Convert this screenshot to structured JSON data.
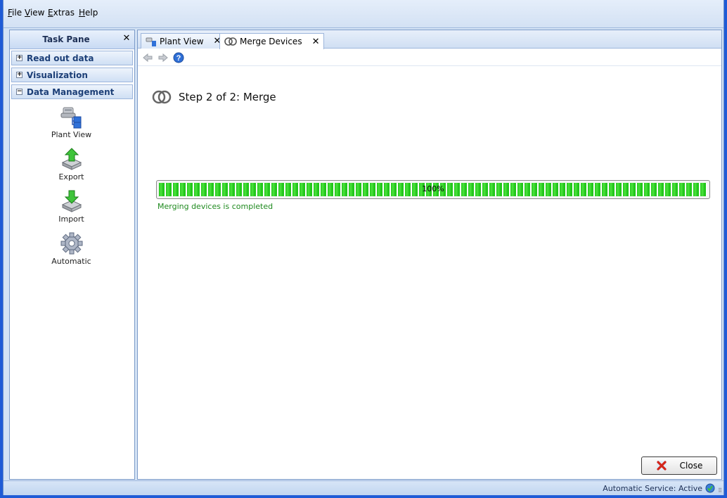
{
  "menu": {
    "file": {
      "ul": "F",
      "rest": "ile"
    },
    "view": {
      "ul": "V",
      "rest": "iew"
    },
    "extras": {
      "ul": "E",
      "rest": "xtras"
    },
    "help": {
      "ul": "H",
      "rest": "elp"
    }
  },
  "task_pane": {
    "title": "Task Pane",
    "groups": [
      {
        "label": "Read out data",
        "state": "+"
      },
      {
        "label": "Visualization",
        "state": "+"
      },
      {
        "label": "Data Management",
        "state": "−"
      }
    ],
    "items": [
      {
        "label": "Plant View",
        "icon": "plant-view-icon"
      },
      {
        "label": "Export",
        "icon": "export-icon"
      },
      {
        "label": "Import",
        "icon": "import-icon"
      },
      {
        "label": "Automatic",
        "icon": "gear-icon"
      }
    ]
  },
  "tabs": [
    {
      "label": "Plant View",
      "active": false
    },
    {
      "label": "Merge Devices",
      "active": true
    }
  ],
  "content": {
    "step_title": "Step 2 of 2: Merge",
    "progress_percent": 100,
    "progress_label": "100%",
    "progress_message": "Merging devices is completed",
    "close_label": "Close"
  },
  "status": {
    "text": "Automatic Service: Active"
  },
  "colors": {
    "progress_green": "#21c61a",
    "message_green": "#1f8a1f",
    "window_blue": "#d4e3f5"
  }
}
